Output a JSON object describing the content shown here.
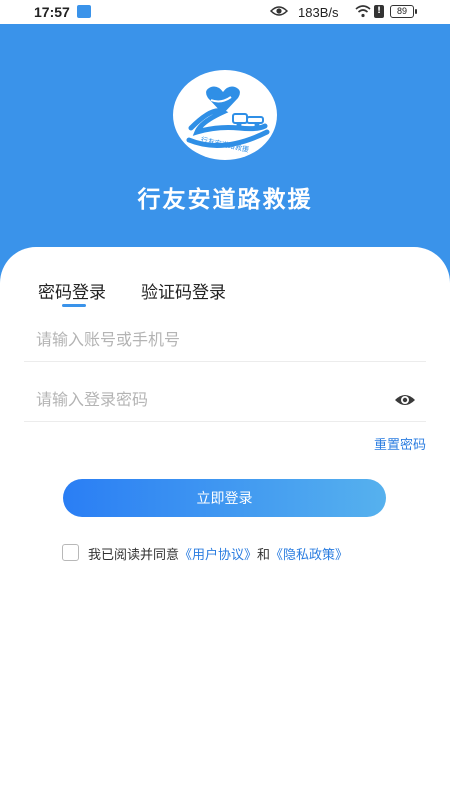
{
  "status_bar": {
    "time": "17:57",
    "network_speed": "183B/s",
    "battery_level": "89",
    "icons": [
      "app-notification-icon",
      "eye-icon",
      "wifi-icon",
      "alert-icon",
      "battery-icon"
    ]
  },
  "header": {
    "logo_text": "行友安道路救援",
    "app_name": "行友安道路救援",
    "background_color": "#3a93ea"
  },
  "tabs": [
    {
      "label": "密码登录",
      "active": true
    },
    {
      "label": "验证码登录",
      "active": false
    }
  ],
  "form": {
    "account_placeholder": "请输入账号或手机号",
    "password_placeholder": "请输入登录密码",
    "reset_password_label": "重置密码",
    "login_button_label": "立即登录"
  },
  "agreement": {
    "prefix": "我已阅读并同意",
    "user_agreement": "《用户协议》",
    "conjunction": "和",
    "privacy_policy": "《隐私政策》",
    "checked": false
  },
  "colors": {
    "accent": "#3a93ea",
    "link": "#2b7de0",
    "button_gradient_start": "#2a7ef4",
    "button_gradient_end": "#56b1ee"
  }
}
